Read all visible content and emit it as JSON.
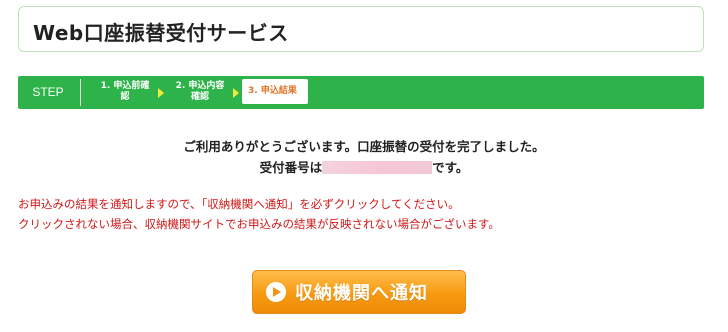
{
  "header": {
    "title": "Web口座振替受付サービス"
  },
  "steps": {
    "label": "STEP",
    "items": [
      {
        "line1": "1. 申込前確",
        "line2": "認"
      },
      {
        "line1": "2. 申込内容",
        "line2": "確認"
      }
    ],
    "current": "3. 申込結果"
  },
  "main": {
    "message": "ご利用ありがとうございます。口座振替の受付を完了しました。",
    "receipt_prefix": "受付番号は",
    "receipt_suffix": "です。",
    "notice_line1": "お申込みの結果を通知しますので、「収納機関へ通知」を必ずクリックしてください。",
    "notice_line2": "クリックされない場合、収納機関サイトでお申込みの結果が反映されない場合がございます。"
  },
  "button": {
    "label": "収納機関へ通知",
    "icon": "play-circle-icon"
  },
  "colors": {
    "step_bar": "#2db34a",
    "notice": "#d01818",
    "button": "#f79a12",
    "current_step": "#e2752a"
  }
}
